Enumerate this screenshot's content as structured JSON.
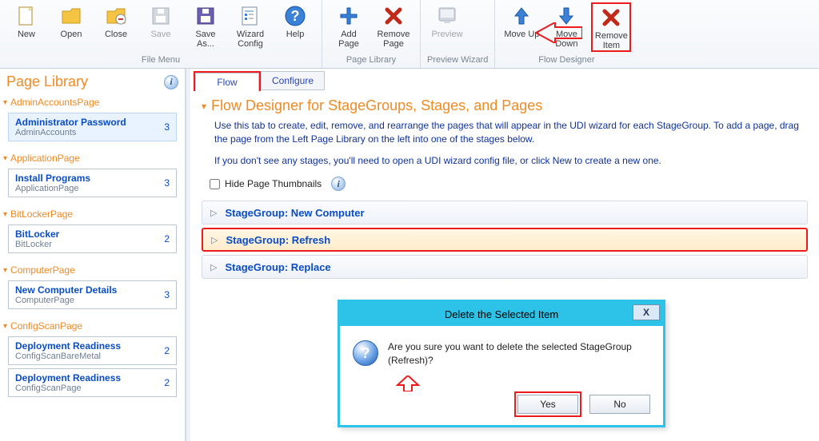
{
  "ribbon": {
    "groups": [
      {
        "label": "File Menu",
        "items": [
          {
            "id": "new",
            "label": "New"
          },
          {
            "id": "open",
            "label": "Open"
          },
          {
            "id": "close",
            "label": "Close"
          },
          {
            "id": "save",
            "label": "Save",
            "disabled": true
          },
          {
            "id": "saveas",
            "label": "Save As..."
          },
          {
            "id": "wizardconfig",
            "label": "Wizard Config"
          },
          {
            "id": "help",
            "label": "Help"
          }
        ]
      },
      {
        "label": "Page Library",
        "items": [
          {
            "id": "addpage",
            "label": "Add Page"
          },
          {
            "id": "removepage",
            "label": "Remove Page"
          }
        ]
      },
      {
        "label": "Preview Wizard",
        "items": [
          {
            "id": "preview",
            "label": "Preview",
            "disabled": true
          }
        ]
      },
      {
        "label": "Flow Designer",
        "items": [
          {
            "id": "moveup",
            "label": "Move Up"
          },
          {
            "id": "movedown",
            "label": "Move Down"
          },
          {
            "id": "removeitem",
            "label": "Remove Item",
            "highlight": true
          }
        ]
      }
    ]
  },
  "sidebar": {
    "title": "Page Library",
    "sections": [
      {
        "head": "AdminAccountsPage",
        "items": [
          {
            "title": "Administrator Password",
            "sub": "AdminAccounts",
            "count": 3,
            "selected": true
          }
        ]
      },
      {
        "head": "ApplicationPage",
        "items": [
          {
            "title": "Install Programs",
            "sub": "ApplicationPage",
            "count": 3
          }
        ]
      },
      {
        "head": "BitLockerPage",
        "items": [
          {
            "title": "BitLocker",
            "sub": "BitLocker",
            "count": 2
          }
        ]
      },
      {
        "head": "ComputerPage",
        "items": [
          {
            "title": "New Computer Details",
            "sub": "ComputerPage",
            "count": 3
          }
        ]
      },
      {
        "head": "ConfigScanPage",
        "items": [
          {
            "title": "Deployment Readiness",
            "sub": "ConfigScanBareMetal",
            "count": 2
          },
          {
            "title": "Deployment Readiness",
            "sub": "ConfigScanPage",
            "count": 2
          }
        ]
      }
    ]
  },
  "main": {
    "tabs": {
      "flow": "Flow",
      "configure": "Configure"
    },
    "title": "Flow Designer for StageGroups, Stages, and Pages",
    "desc1": "Use this tab to create, edit, remove, and rearrange the pages that will appear in the UDI wizard for each StageGroup. To add a page, drag the page from the Left Page Library on the left into one of the stages below.",
    "desc2": "If you don't see any stages, you'll need to open a UDI wizard config file, or click New to create a new one.",
    "hide_label": "Hide Page Thumbnails",
    "stagegroups": [
      {
        "label": "StageGroup: New Computer"
      },
      {
        "label": "StageGroup: Refresh",
        "highlight": true
      },
      {
        "label": "StageGroup: Replace"
      }
    ]
  },
  "dialog": {
    "title": "Delete the Selected Item",
    "message": "Are you sure you want to delete the selected StageGroup (Refresh)?",
    "yes": "Yes",
    "no": "No",
    "close": "X"
  }
}
